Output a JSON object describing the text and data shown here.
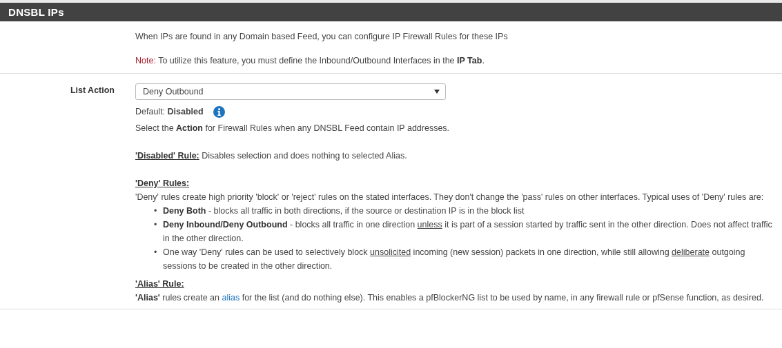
{
  "panel": {
    "title": "DNSBL IPs"
  },
  "intro": [
    [
      {
        "kind": "plain",
        "text": "When IPs are found in any Domain based Feed, you can configure IP Firewall Rules for these IPs"
      }
    ],
    [
      {
        "kind": "note",
        "text": "Note:"
      },
      {
        "kind": "plain",
        "text": " To utilize this feature, you must define the Inbound/Outbound Interfaces in the "
      },
      {
        "kind": "bold",
        "text": "IP Tab"
      },
      {
        "kind": "plain",
        "text": "."
      }
    ]
  ],
  "field": {
    "label": "List Action",
    "value": "Deny Outbound",
    "default_label": "Default: ",
    "default_value": "Disabled"
  },
  "help": [
    {
      "kind": "para",
      "parts": [
        {
          "kind": "plain",
          "text": "Select the "
        },
        {
          "kind": "bold",
          "text": "Action"
        },
        {
          "kind": "plain",
          "text": " for Firewall Rules when any DNSBL Feed contain IP addresses."
        }
      ]
    },
    {
      "kind": "para",
      "parts": [
        {
          "kind": "heading",
          "text": "'Disabled' Rule:"
        },
        {
          "kind": "plain",
          "text": " Disables selection and does nothing to selected Alias."
        }
      ]
    },
    {
      "kind": "heading",
      "parts": [
        {
          "kind": "heading",
          "text": "'Deny' Rules:"
        }
      ]
    },
    {
      "kind": "line",
      "parts": [
        {
          "kind": "plain",
          "text": "'Deny' rules create high priority 'block' or 'reject' rules on the stated interfaces. They don't change the 'pass' rules on other interfaces. Typical uses of 'Deny' rules are:"
        }
      ]
    },
    {
      "kind": "bullet",
      "marker": "•",
      "parts": [
        {
          "kind": "bold",
          "text": "Deny Both"
        },
        {
          "kind": "plain",
          "text": " - blocks all traffic in both directions, if the source or destination IP is in the block list"
        }
      ]
    },
    {
      "kind": "bullet",
      "marker": "•",
      "parts": [
        {
          "kind": "bold",
          "text": "Deny Inbound/Deny Outbound"
        },
        {
          "kind": "plain",
          "text": " - blocks all traffic in one direction "
        },
        {
          "kind": "underline",
          "text": "unless"
        },
        {
          "kind": "plain",
          "text": " it is part of a session started by traffic sent in the other direction. Does not affect traffic in the other direction."
        }
      ]
    },
    {
      "kind": "bullet",
      "marker": "•",
      "parts": [
        {
          "kind": "plain",
          "text": "One way 'Deny' rules can be used to selectively block "
        },
        {
          "kind": "underline",
          "text": "unsolicited"
        },
        {
          "kind": "plain",
          "text": " incoming (new session) packets in one direction, while still allowing "
        },
        {
          "kind": "underline",
          "text": "deliberate"
        },
        {
          "kind": "plain",
          "text": " outgoing sessions to be created in the other direction."
        }
      ]
    },
    {
      "kind": "heading",
      "parts": [
        {
          "kind": "heading",
          "text": "'Alias' Rule:"
        }
      ]
    },
    {
      "kind": "line",
      "parts": [
        {
          "kind": "bold",
          "text": "'Alias'"
        },
        {
          "kind": "plain",
          "text": " rules create an "
        },
        {
          "kind": "link",
          "text": "alias"
        },
        {
          "kind": "plain",
          "text": " for the list (and do nothing else). This enables a pfBlockerNG list to be used by name, in any firewall rule or pfSense function, as desired."
        }
      ]
    }
  ]
}
